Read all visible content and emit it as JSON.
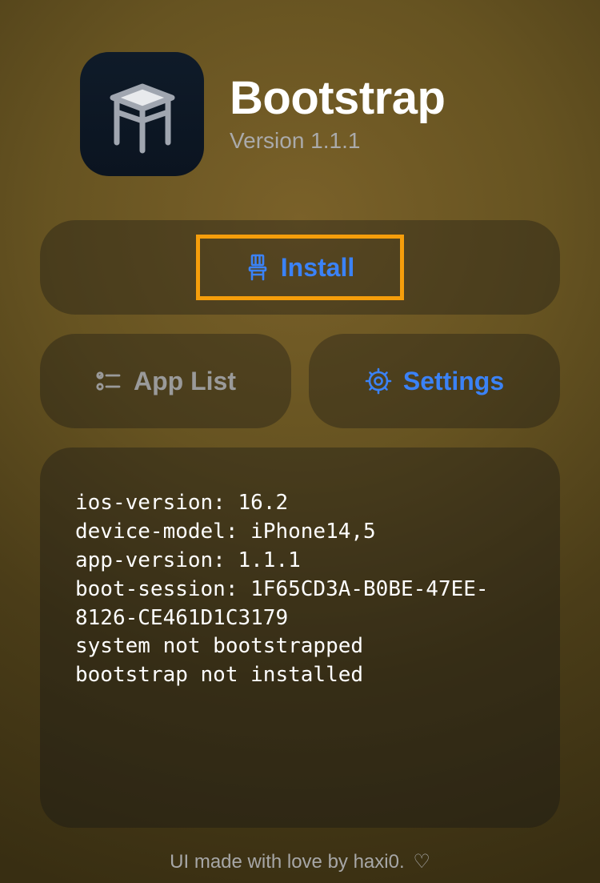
{
  "app": {
    "name": "Bootstrap",
    "version_label": "Version 1.1.1"
  },
  "buttons": {
    "install": "Install",
    "app_list": "App List",
    "settings": "Settings"
  },
  "log": "ios-version: 16.2\ndevice-model: iPhone14,5\napp-version: 1.1.1\nboot-session: 1F65CD3A-B0BE-47EE-8126-CE461D1C3179\nsystem not bootstrapped\nbootstrap not installed",
  "footer": {
    "text": "UI made with love by haxi0.",
    "heart": "♡"
  },
  "colors": {
    "accent": "#3b82f6",
    "highlight": "#f59e0b",
    "disabled": "#9a9a9a"
  }
}
